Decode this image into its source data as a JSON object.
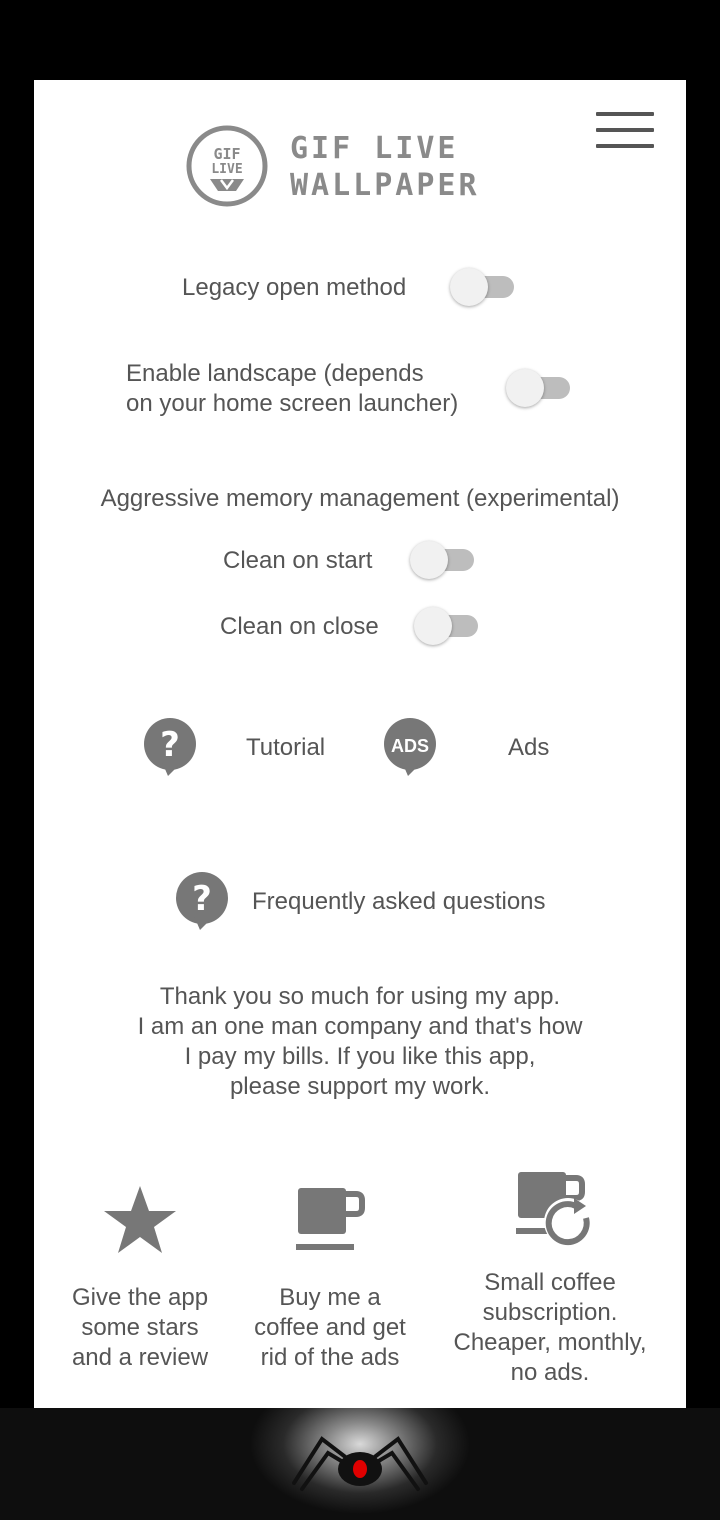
{
  "header": {
    "logo_badge_line1": "GIF",
    "logo_badge_line2": "LIVE",
    "app_title_line1": "GIF LIVE",
    "app_title_line2": "WALLPAPER",
    "menu_icon": "hamburger-menu-icon"
  },
  "settings": {
    "legacy_open_label": "Legacy open method",
    "legacy_open_on": false,
    "landscape_line1": "Enable landscape (depends",
    "landscape_line2": "on your home screen launcher)",
    "landscape_on": false,
    "memory_heading": "Aggressive memory management (experimental)",
    "clean_start_label": "Clean on start",
    "clean_start_on": false,
    "clean_close_label": "Clean on close",
    "clean_close_on": false
  },
  "links": {
    "tutorial_label": "Tutorial",
    "tutorial_icon": "question-bubble-icon",
    "ads_badge": "ADS",
    "ads_label": "Ads",
    "ads_icon": "ads-bubble-icon",
    "faq_label": "Frequently asked questions",
    "faq_icon": "question-bubble-icon"
  },
  "support_message": {
    "line1": "Thank you so much for using my app.",
    "line2": "I am an one man company and that's how",
    "line3": "I pay my bills. If you like this app,",
    "line4": "please support my work."
  },
  "actions": [
    {
      "icon": "star-icon",
      "line1": "Give the app",
      "line2": "some stars",
      "line3": "and a review"
    },
    {
      "icon": "coffee-cup-icon",
      "line1": "Buy me a",
      "line2": "coffee and get",
      "line3": "rid of the ads"
    },
    {
      "icon": "coffee-subscription-icon",
      "line1": "Small coffee",
      "line2": "subscription.",
      "line3": "Cheaper, monthly,",
      "line4": "no ads."
    }
  ],
  "colors": {
    "background": "#000000",
    "panel": "#ffffff",
    "text": "#555555",
    "icon": "#777777",
    "toggle_track": "#bdbdbd",
    "toggle_thumb": "#f1f1f1",
    "spider_eye": "#e00000"
  }
}
